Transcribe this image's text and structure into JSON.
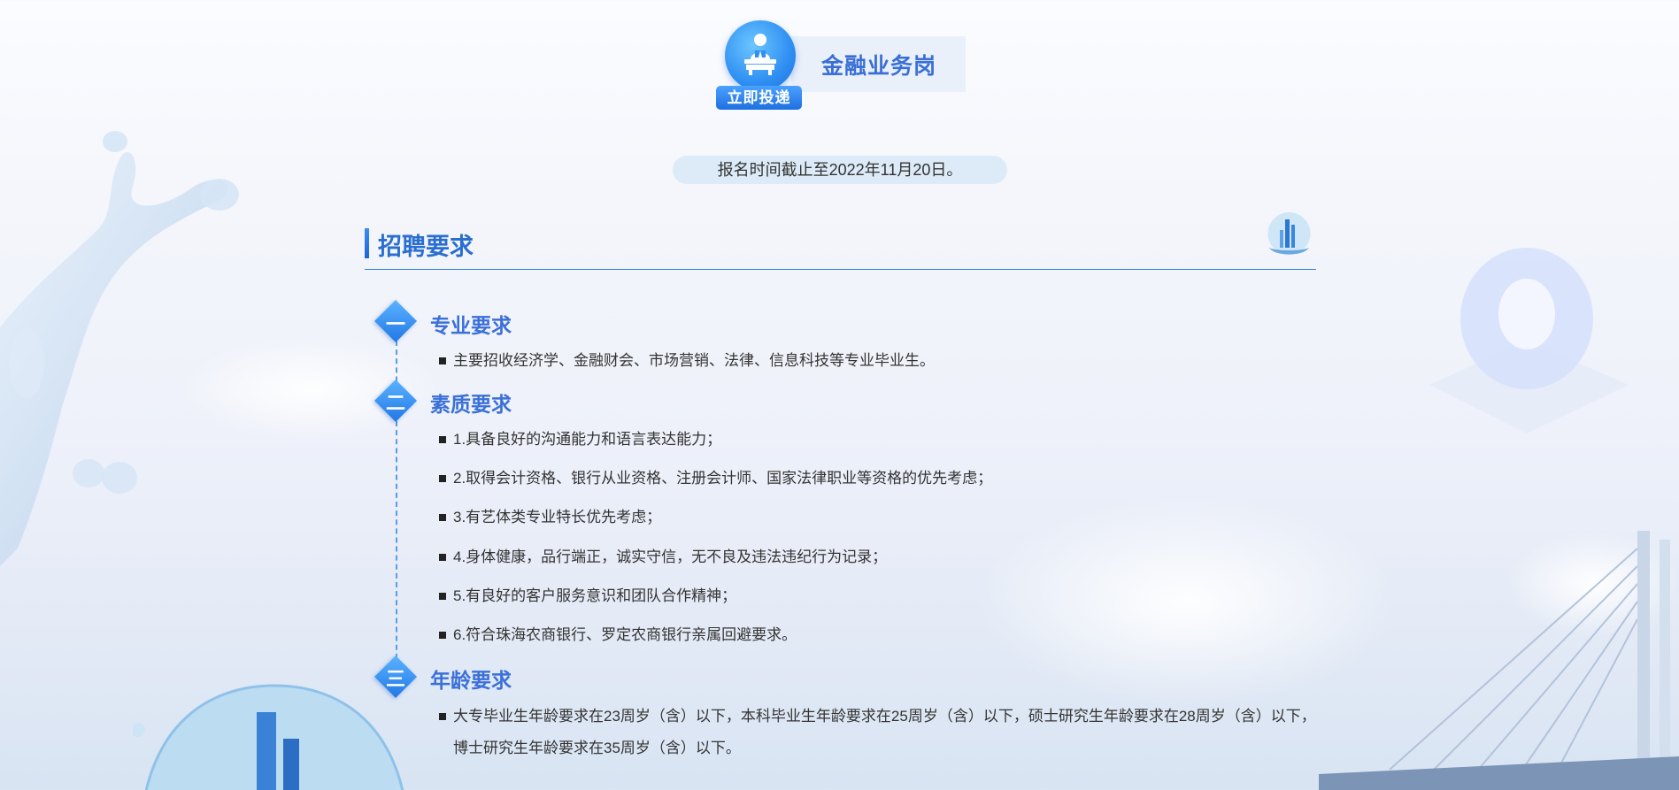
{
  "job": {
    "apply_label": "立即投递",
    "title": "金融业务岗"
  },
  "deadline": "报名时间截止至2022年11月20日。",
  "section": {
    "title": "招聘要求"
  },
  "groups": [
    {
      "number": "一",
      "title": "专业要求",
      "items": [
        "主要招收经济学、金融财会、市场营销、法律、信息科技等专业毕业生。"
      ]
    },
    {
      "number": "二",
      "title": "素质要求",
      "items": [
        "1.具备良好的沟通能力和语言表达能力；",
        "2.取得会计资格、银行从业资格、注册会计师、国家法律职业等资格的优先考虑；",
        "3.有艺体类专业特长优先考虑；",
        "4.身体健康，品行端正，诚实守信，无不良及违法违纪行为记录；",
        "5.有良好的客户服务意识和团队合作精神；",
        "6.符合珠海农商银行、罗定农商银行亲属回避要求。"
      ]
    },
    {
      "number": "三",
      "title": "年龄要求",
      "items": [
        "大专毕业生年龄要求在23周岁（含）以下，本科毕业生年龄要求在25周岁（含）以下，硕士研究生年龄要求在28周岁（含）以下，",
        "博士研究生年龄要求在35周岁（含）以下。"
      ]
    }
  ],
  "colors": {
    "accent": "#2f7fd8",
    "heading": "#3a70d8",
    "card_bg": "#e9f0fa",
    "deadline_bg": "#dcebf7"
  },
  "icons": {
    "apply": "person-at-desk-icon",
    "section_logo": "city-shell-logo-icon",
    "bullet": "square-bullet-icon"
  }
}
